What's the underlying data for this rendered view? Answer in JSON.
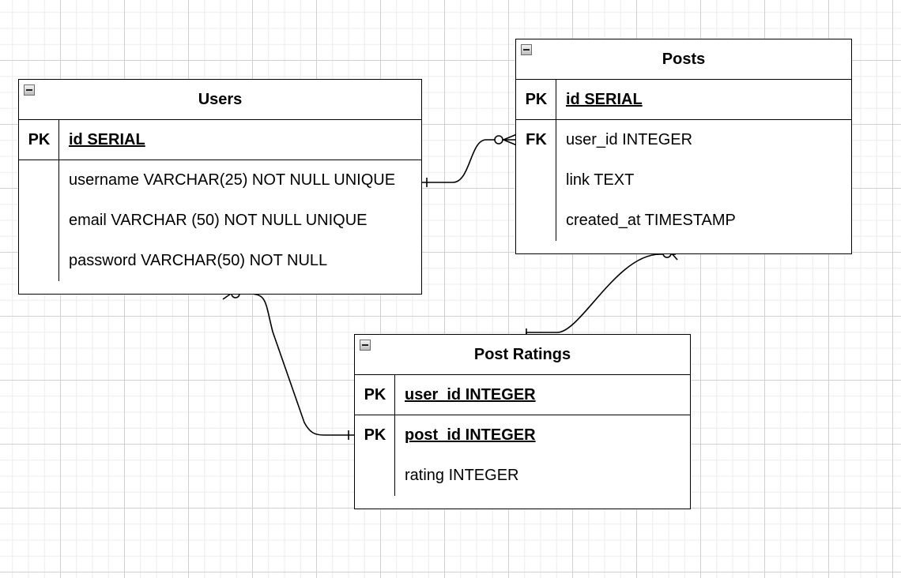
{
  "tables": {
    "users": {
      "title": "Users",
      "rows": [
        {
          "key": "PK",
          "field": "id SERIAL"
        },
        {
          "key": "",
          "field": "username VARCHAR(25) NOT NULL UNIQUE"
        },
        {
          "key": "",
          "field": "email VARCHAR (50) NOT NULL UNIQUE"
        },
        {
          "key": "",
          "field": "password VARCHAR(50) NOT NULL"
        }
      ]
    },
    "posts": {
      "title": "Posts",
      "rows": [
        {
          "key": "PK",
          "field": "id SERIAL"
        },
        {
          "key": "FK",
          "field": "user_id INTEGER"
        },
        {
          "key": "",
          "field": "link TEXT"
        },
        {
          "key": "",
          "field": "created_at TIMESTAMP"
        }
      ]
    },
    "post_ratings": {
      "title": "Post Ratings",
      "rows": [
        {
          "key": "PK",
          "field": "user_id INTEGER"
        },
        {
          "key": "PK",
          "field": "post_id INTEGER"
        },
        {
          "key": "",
          "field": "rating INTEGER"
        }
      ]
    }
  },
  "relationships": [
    {
      "from": "users.username",
      "from_cardinality": "one",
      "to": "posts.user_id",
      "to_cardinality": "zero-or-many"
    },
    {
      "from": "post_ratings",
      "from_cardinality": "one",
      "to": "posts",
      "to_cardinality": "zero-or-many"
    },
    {
      "from": "users",
      "from_cardinality": "zero-or-many",
      "to": "post_ratings.post_id",
      "to_cardinality": "one"
    }
  ],
  "colors": {
    "line": "#000000",
    "grid_major": "#d0d0d0",
    "grid_minor": "#ececec",
    "background": "#ffffff"
  }
}
